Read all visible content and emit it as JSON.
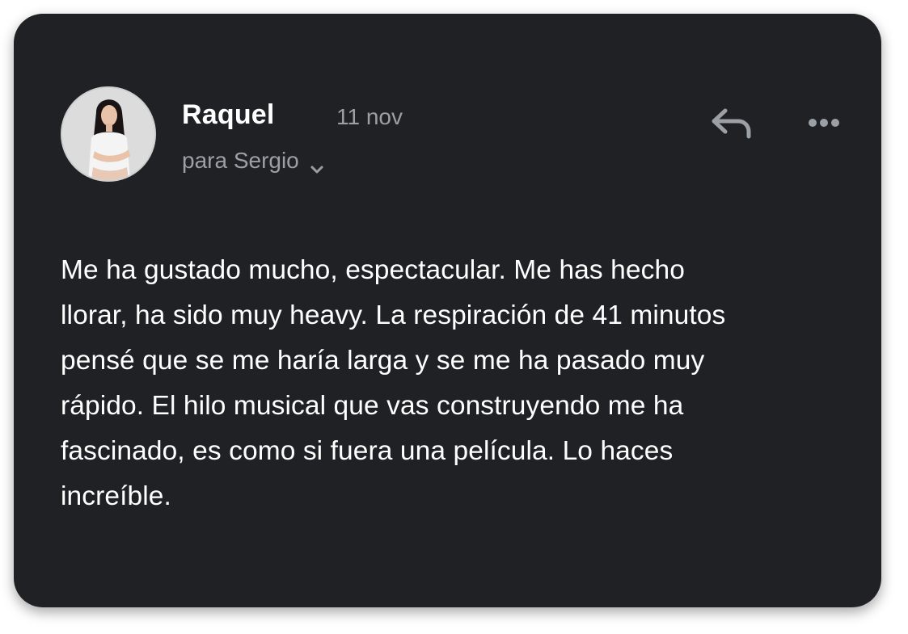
{
  "message": {
    "sender_name": "Raquel",
    "date": "11 nov",
    "recipient_line": "para Sergio",
    "body": "Me ha gustado mucho, espectacular. Me has hecho\nllorar, ha sido muy heavy. La respiración de 41 minutos\npensé que se me haría larga y se me ha pasado muy\nrápido. El hilo musical que vas construyendo me ha\nfascinado, es como si fuera una película. Lo haces\nincreíble."
  },
  "icons": {
    "reply": "reply-arrow-icon",
    "more": "more-horizontal-icon",
    "expand": "chevron-down-icon"
  },
  "colors": {
    "card_background": "#202125",
    "primary_text": "#ffffff",
    "secondary_text": "#9aa0a6"
  }
}
